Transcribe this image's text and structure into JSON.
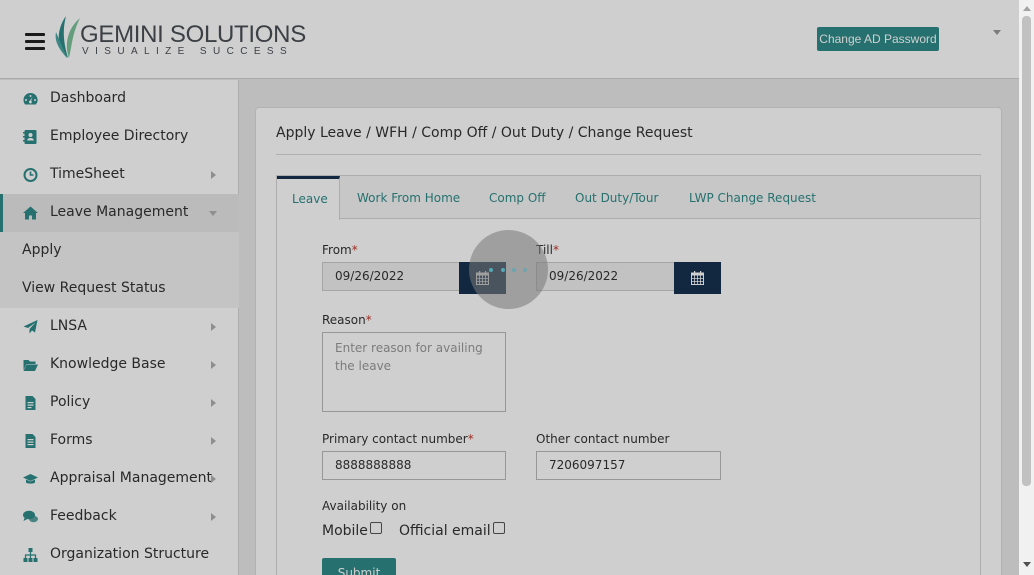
{
  "header": {
    "logo_text": "GEMINI SOLUTIONS",
    "logo_tagline": "VISUALIZE SUCCESS",
    "change_password_label": "Change AD Password"
  },
  "sidebar": {
    "items": [
      {
        "label": "Dashboard",
        "icon": "dashboard-gauge-icon",
        "has_submenu": false
      },
      {
        "label": "Employee Directory",
        "icon": "address-book-icon",
        "has_submenu": false
      },
      {
        "label": "TimeSheet",
        "icon": "clock-icon",
        "has_submenu": true
      },
      {
        "label": "Leave Management",
        "icon": "home-icon",
        "has_submenu": true,
        "expanded": true
      },
      {
        "label": "LNSA",
        "icon": "paper-plane-icon",
        "has_submenu": true
      },
      {
        "label": "Knowledge Base",
        "icon": "folder-open-icon",
        "has_submenu": true
      },
      {
        "label": "Policy",
        "icon": "file-text-icon",
        "has_submenu": true
      },
      {
        "label": "Forms",
        "icon": "file-list-icon",
        "has_submenu": true
      },
      {
        "label": "Appraisal Management",
        "icon": "graduation-cap-icon",
        "has_submenu": true
      },
      {
        "label": "Feedback",
        "icon": "comments-icon",
        "has_submenu": true
      },
      {
        "label": "Organization Structure",
        "icon": "sitemap-icon",
        "has_submenu": false
      }
    ],
    "sub_items": [
      {
        "label": "Apply"
      },
      {
        "label": "View Request Status"
      }
    ]
  },
  "main": {
    "title": "Apply Leave / WFH / Comp Off / Out Duty / Change Request",
    "tabs": [
      {
        "label": "Leave",
        "active": true
      },
      {
        "label": "Work From Home",
        "active": false
      },
      {
        "label": "Comp Off",
        "active": false
      },
      {
        "label": "Out Duty/Tour",
        "active": false
      },
      {
        "label": "LWP Change Request",
        "active": false
      }
    ],
    "form": {
      "from_label": "From",
      "from_value": "09/26/2022",
      "till_label": "Till",
      "till_value": "09/26/2022",
      "reason_label": "Reason",
      "reason_placeholder": "Enter reason for availing the leave",
      "primary_contact_label": "Primary contact number",
      "primary_contact_value": "8888888888",
      "other_contact_label": "Other contact number",
      "other_contact_value": "7206097157",
      "availability_label": "Availability on",
      "mobile_label": "Mobile",
      "official_email_label": "Official email",
      "required_mark": "*",
      "submit_label": "Submit"
    }
  },
  "colors": {
    "accent": "#2f8c8a",
    "dark_navy": "#16324f",
    "required": "#c0392b"
  }
}
